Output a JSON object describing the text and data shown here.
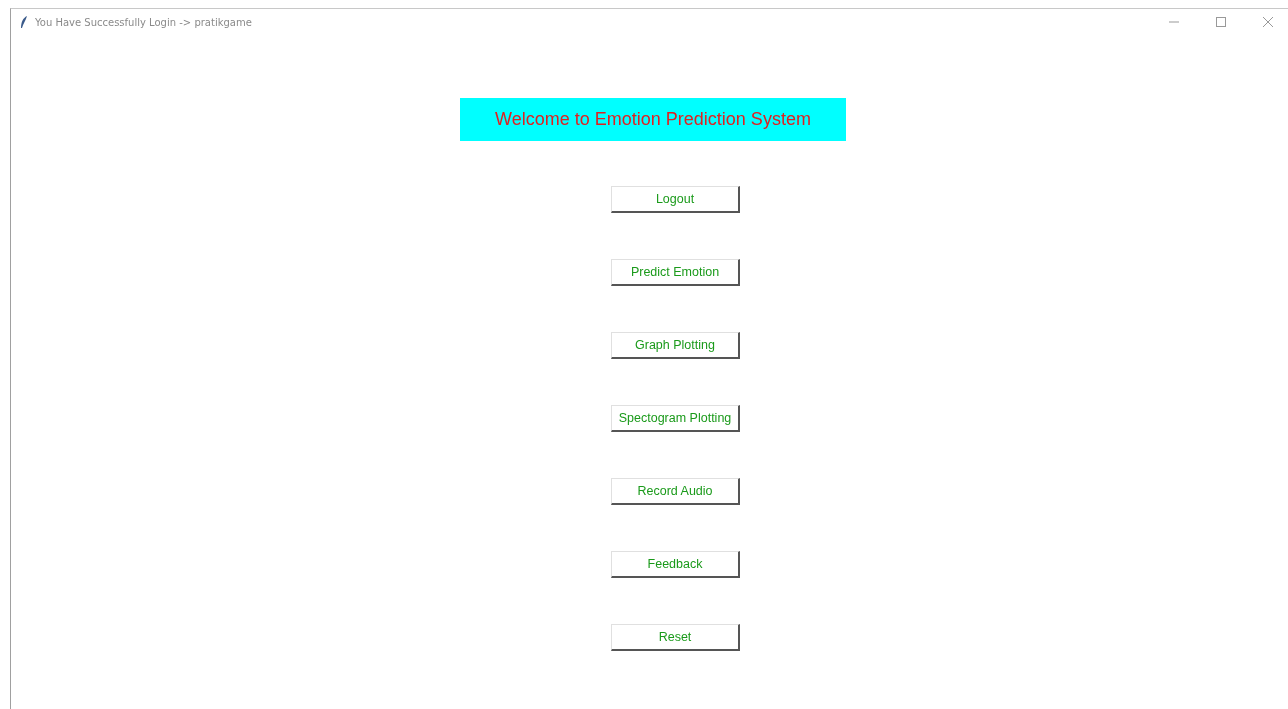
{
  "window": {
    "title": "You Have Successfully Login -> pratikgame"
  },
  "banner": {
    "text": "Welcome to Emotion Prediction System"
  },
  "buttons": [
    {
      "label": "Logout"
    },
    {
      "label": "Predict Emotion"
    },
    {
      "label": "Graph Plotting"
    },
    {
      "label": "Spectogram Plotting"
    },
    {
      "label": "Record Audio"
    },
    {
      "label": "Feedback"
    },
    {
      "label": "Reset"
    }
  ]
}
